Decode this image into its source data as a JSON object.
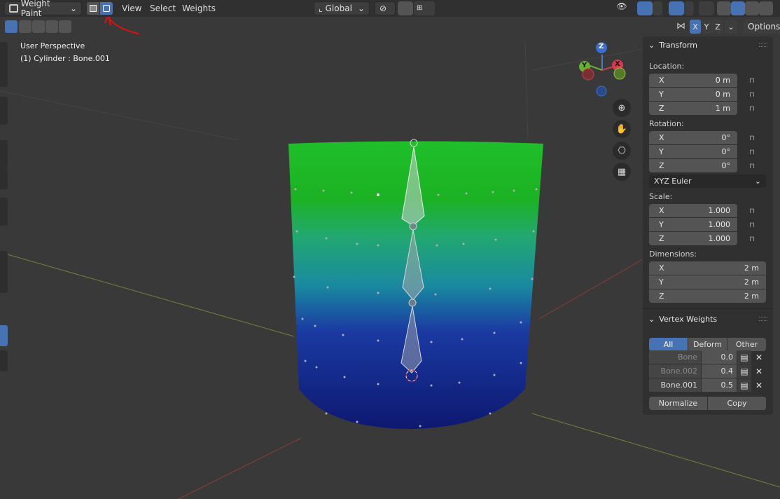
{
  "header": {
    "mode": "Weight Paint",
    "menus": [
      "View",
      "Select",
      "Weights"
    ],
    "orientation": "Global"
  },
  "axis_toggles": [
    "X",
    "Y",
    "Z"
  ],
  "options_label": "Options",
  "viewport": {
    "perspective": "User Perspective",
    "object": "(1) Cylinder : Bone.001"
  },
  "gizmo": {
    "x": "X",
    "y": "Y",
    "z": "Z"
  },
  "transform": {
    "title": "Transform",
    "location_label": "Location:",
    "location": [
      {
        "axis": "X",
        "value": "0 m"
      },
      {
        "axis": "Y",
        "value": "0 m"
      },
      {
        "axis": "Z",
        "value": "1 m"
      }
    ],
    "rotation_label": "Rotation:",
    "rotation": [
      {
        "axis": "X",
        "value": "0°"
      },
      {
        "axis": "Y",
        "value": "0°"
      },
      {
        "axis": "Z",
        "value": "0°"
      }
    ],
    "rotation_mode": "XYZ Euler",
    "scale_label": "Scale:",
    "scale": [
      {
        "axis": "X",
        "value": "1.000"
      },
      {
        "axis": "Y",
        "value": "1.000"
      },
      {
        "axis": "Z",
        "value": "1.000"
      }
    ],
    "dimensions_label": "Dimensions:",
    "dimensions": [
      {
        "axis": "X",
        "value": "2 m"
      },
      {
        "axis": "Y",
        "value": "2 m"
      },
      {
        "axis": "Z",
        "value": "2 m"
      }
    ]
  },
  "vertex_weights": {
    "title": "Vertex Weights",
    "tabs": [
      "All",
      "Deform",
      "Other"
    ],
    "bones": [
      {
        "name": "Bone",
        "value": "0.0"
      },
      {
        "name": "Bone.002",
        "value": "0.4"
      },
      {
        "name": "Bone.001",
        "value": "0.5"
      }
    ],
    "normalize": "Normalize",
    "copy": "Copy"
  },
  "colors": {
    "accent": "#4772b3",
    "annotation": "#e01010",
    "header_bg": "#303030",
    "viewport_bg": "#393939"
  }
}
